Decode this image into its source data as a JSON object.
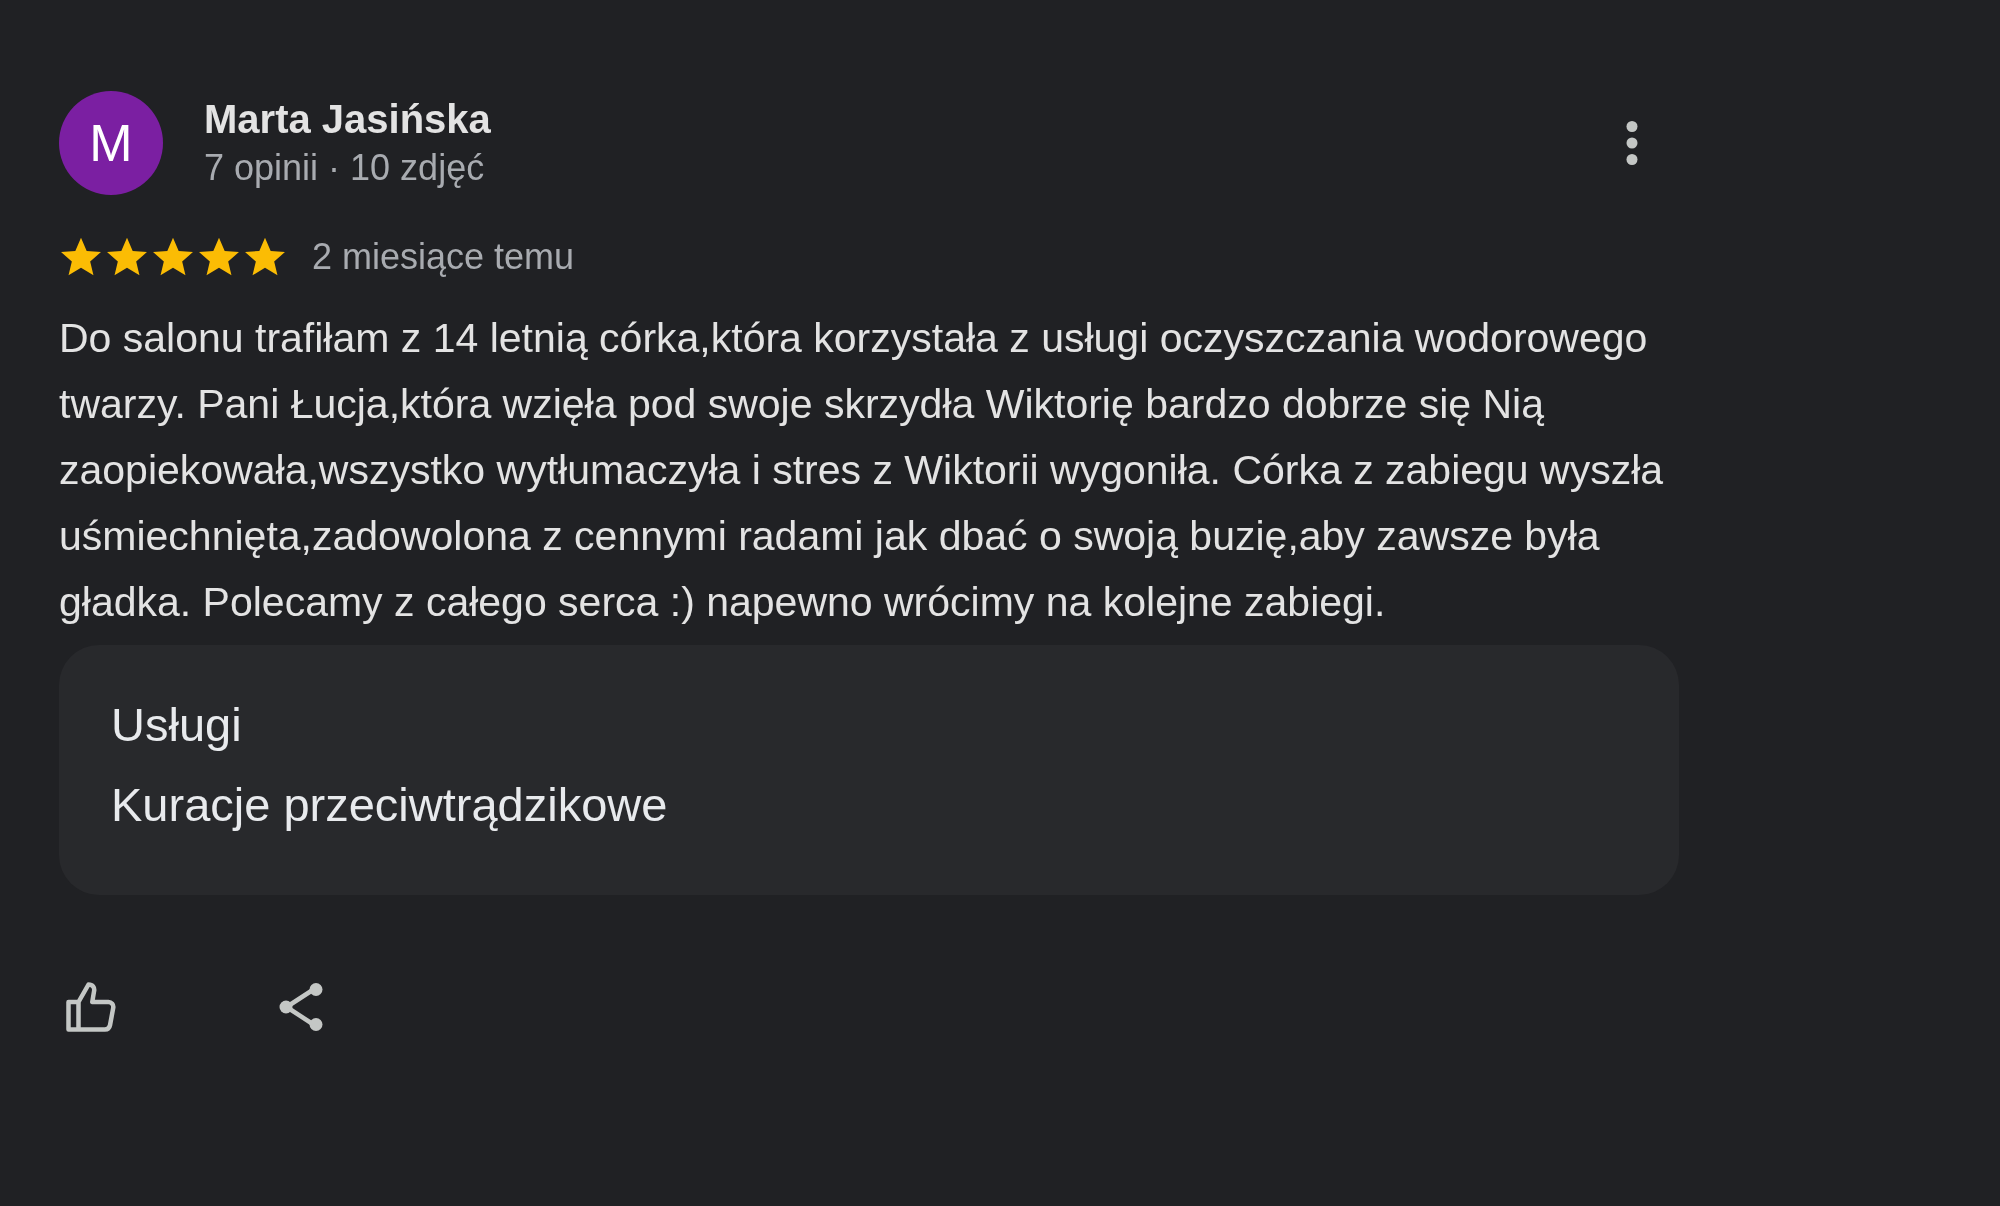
{
  "review": {
    "avatar_initial": "M",
    "author": "Marta Jasińska",
    "meta": "7 opinii · 10 zdjęć",
    "stars": 5,
    "date": "2 miesiące temu",
    "text": "Do salonu trafiłam z 14 letnią córka,która korzystała z usługi oczyszczania wodorowego twarzy. Pani Łucja,która wzięła pod swoje skrzydła Wiktorię bardzo dobrze się Nią zaopiekowała,wszystko wytłumaczyła i stres z Wiktorii wygoniła. Córka z zabiegu wyszła uśmiechnięta,zadowolona z cennymi radami jak dbać o swoją buzię,aby zawsze była gładka. Polecamy z całego serca :) napewno wrócimy na kolejne zabiegi.",
    "services": {
      "label": "Usługi",
      "value": "Kuracje przeciwtrądzikowe"
    }
  }
}
